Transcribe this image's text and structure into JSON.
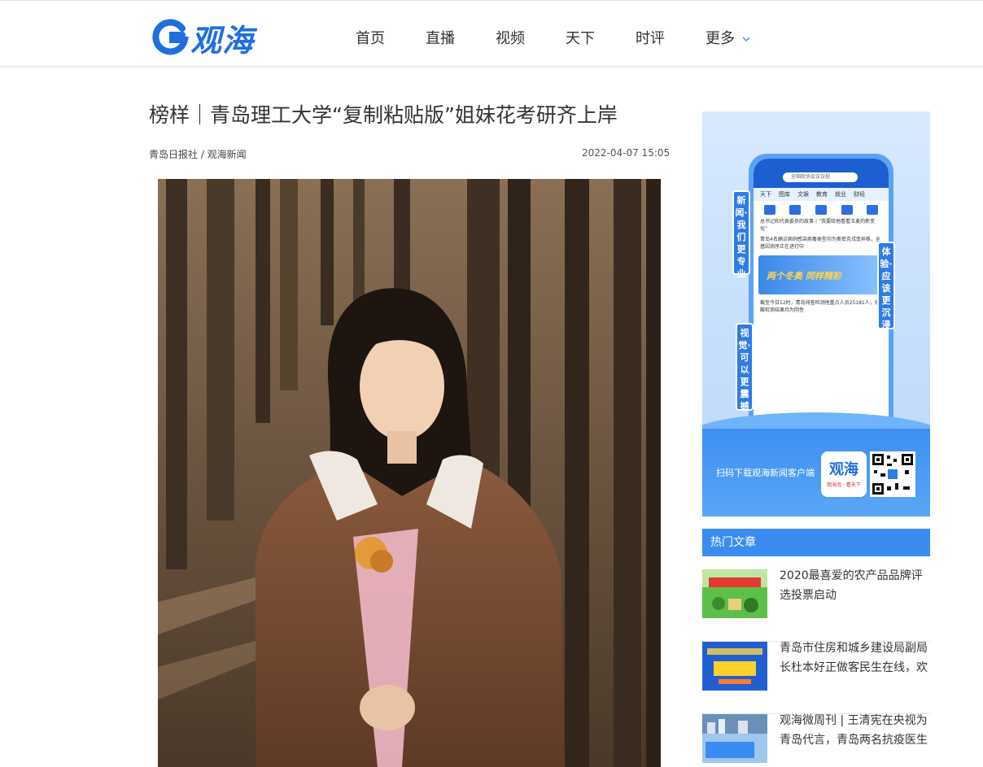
{
  "header": {
    "logo_text": "观海",
    "nav": [
      {
        "label": "首页"
      },
      {
        "label": "直播"
      },
      {
        "label": "视频"
      },
      {
        "label": "天下"
      },
      {
        "label": "时评"
      },
      {
        "label": "更多"
      }
    ]
  },
  "article": {
    "title": "榜样｜青岛理工大学“复制粘贴版”姐妹花考研齐上岸",
    "source": "青岛日报社 / 观海新闻",
    "time": "2022-04-07 15:05"
  },
  "ad": {
    "tags": [
      "新闻·我们更专业",
      "体验·应该更沉浸",
      "视觉·可以更震撼"
    ],
    "phone_search": "全国政协会议议程",
    "phone_tabs": [
      "天下",
      "图库",
      "文娱",
      "教育",
      "就业",
      "财经"
    ],
    "phone_lines": [
      "总书记和代表委员的故事丨“我要给他看看玉麦的新变化”",
      "青岛4名确诊病例感染病毒类型均为奥密克戎变异株，全基因测序正在进行中",
      "截至今日12时，青岛排查检测他重点人员25181人，核酸检测结果均为阴性"
    ],
    "phone_banner": "两个冬奥 同样精彩",
    "caption": "扫码下载观海新闻客户端",
    "app_name": "观海",
    "app_slogan": "观海岛 · 看天下"
  },
  "hot": {
    "heading": "热门文章",
    "items": [
      {
        "title": "2020最喜爱的农产品品牌评选投票启动"
      },
      {
        "title": "青岛市住房和城乡建设局副局长杜本好正做客民生在线，欢"
      },
      {
        "title": "观海微周刊 | 王清宪在央视为青岛代言，青岛两名抗疫医生"
      }
    ]
  },
  "colors": {
    "brand_blue": "#1f6fe0",
    "hot_header": "#3b8cf0"
  }
}
